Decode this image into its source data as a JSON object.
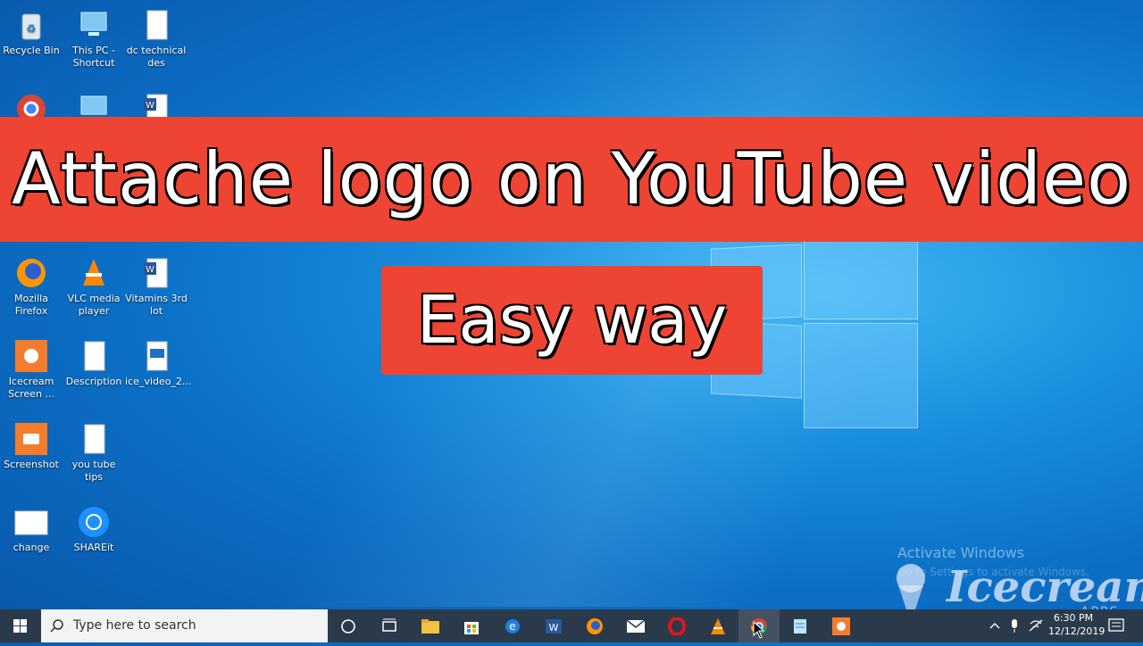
{
  "desktop": {
    "icons": [
      {
        "label": "Recycle Bin",
        "icon": "recycle-bin-icon"
      },
      {
        "label": "This PC - Shortcut",
        "icon": "computer-icon"
      },
      {
        "label": "dc technical des",
        "icon": "document-icon"
      },
      {
        "label": "Mozilla Firefox",
        "icon": "firefox-icon"
      },
      {
        "label": "VLC media player",
        "icon": "vlc-icon"
      },
      {
        "label": "Vitamins 3rd lot",
        "icon": "word-doc-icon"
      },
      {
        "label": "Icecream Screen ...",
        "icon": "icecream-icon"
      },
      {
        "label": "Description",
        "icon": "document-icon"
      },
      {
        "label": "ice_video_2...",
        "icon": "video-file-icon"
      },
      {
        "label": "Screenshot",
        "icon": "screenshot-icon"
      },
      {
        "label": "you tube tips",
        "icon": "document-icon"
      },
      {
        "label": "change",
        "icon": "image-icon"
      },
      {
        "label": "SHAREit",
        "icon": "shareit-icon"
      }
    ]
  },
  "overlay": {
    "title": "Attache logo on YouTube video",
    "subtitle": "Easy way",
    "accent": "#ee4433"
  },
  "watermark": {
    "activate": "Activate Windows",
    "activate_sub": "Go to Settings to activate Windows.",
    "brand": "Icecream",
    "brand_sub": "APPS"
  },
  "taskbar": {
    "search_placeholder": "Type here to search",
    "time": "6:30 PM",
    "date": "12/12/2019"
  }
}
